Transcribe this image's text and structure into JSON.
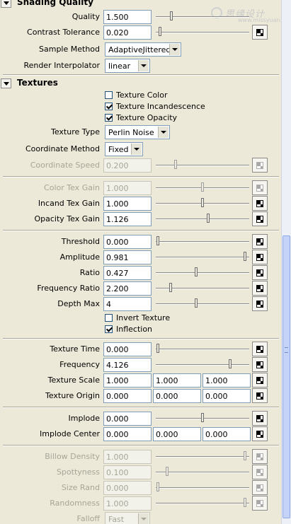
{
  "watermark": {
    "text": "思缘设计",
    "url": "www.missyuan.com"
  },
  "shading_quality": {
    "title": "Shading Quality",
    "quality": {
      "label": "Quality",
      "value": "1.500",
      "slider": 0.15
    },
    "contrast_tolerance": {
      "label": "Contrast Tolerance",
      "value": "0.020",
      "slider": 0.02
    },
    "sample_method": {
      "label": "Sample Method",
      "value": "AdaptiveJittered"
    },
    "render_interpolator": {
      "label": "Render Interpolator",
      "value": "linear"
    }
  },
  "textures": {
    "title": "Textures",
    "texture_color": {
      "label": "Texture Color",
      "checked": false
    },
    "texture_incandescence": {
      "label": "Texture Incandescence",
      "checked": true
    },
    "texture_opacity": {
      "label": "Texture Opacity",
      "checked": true
    },
    "texture_type": {
      "label": "Texture Type",
      "value": "Perlin Noise"
    },
    "coordinate_method": {
      "label": "Coordinate Method",
      "value": "Fixed"
    },
    "coordinate_speed": {
      "label": "Coordinate Speed",
      "value": "0.200",
      "slider": 0.2
    },
    "color_tex_gain": {
      "label": "Color Tex Gain",
      "value": "1.000",
      "slider": 0.5
    },
    "incand_tex_gain": {
      "label": "Incand Tex Gain",
      "value": "1.000",
      "slider": 0.5
    },
    "opacity_tex_gain": {
      "label": "Opacity Tex Gain",
      "value": "1.126",
      "slider": 0.56
    },
    "threshold": {
      "label": "Threshold",
      "value": "0.000",
      "slider": 0.0
    },
    "amplitude": {
      "label": "Amplitude",
      "value": "0.981",
      "slider": 0.98
    },
    "ratio": {
      "label": "Ratio",
      "value": "0.427",
      "slider": 0.43
    },
    "frequency_ratio": {
      "label": "Frequency Ratio",
      "value": "2.200",
      "slider": 0.14
    },
    "depth_max": {
      "label": "Depth Max",
      "value": "4",
      "slider": 0.43
    },
    "invert_texture": {
      "label": "Invert Texture",
      "checked": false
    },
    "inflection": {
      "label": "Inflection",
      "checked": true
    },
    "texture_time": {
      "label": "Texture Time",
      "value": "0.000",
      "slider": 0.0
    },
    "frequency": {
      "label": "Frequency",
      "value": "4.126",
      "slider": 0.81
    },
    "texture_scale": {
      "label": "Texture Scale",
      "x": "1.000",
      "y": "1.000",
      "z": "1.000"
    },
    "texture_origin": {
      "label": "Texture Origin",
      "x": "0.000",
      "y": "0.000",
      "z": "0.000"
    },
    "implode": {
      "label": "Implode",
      "value": "0.000",
      "slider": 0.5
    },
    "implode_center": {
      "label": "Implode Center",
      "x": "0.000",
      "y": "0.000",
      "z": "0.000"
    },
    "billow_density": {
      "label": "Billow Density",
      "value": "1.000",
      "slider": 0.98
    },
    "spottyness": {
      "label": "Spottyness",
      "value": "0.100",
      "slider": 0.1
    },
    "size_rand": {
      "label": "Size Rand",
      "value": "0.000",
      "slider": 0.0
    },
    "randomness": {
      "label": "Randomness",
      "value": "1.000",
      "slider": 0.98
    },
    "falloff": {
      "label": "Falloff",
      "value": "Fast"
    }
  }
}
